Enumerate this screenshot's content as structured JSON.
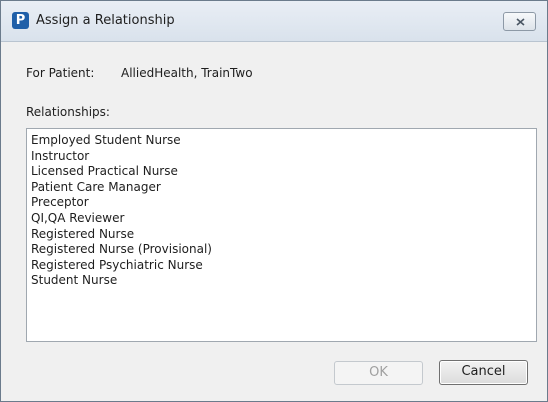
{
  "window": {
    "title": "Assign a Relationship",
    "app_icon_letter": "P"
  },
  "patient": {
    "label": "For Patient:",
    "name": "AlliedHealth, TrainTwo"
  },
  "relationships": {
    "label": "Relationships:",
    "items": [
      "Employed Student Nurse",
      "Instructor",
      "Licensed Practical Nurse",
      "Patient Care Manager",
      "Preceptor",
      "QI,QA Reviewer",
      "Registered Nurse",
      "Registered Nurse (Provisional)",
      "Registered Psychiatric Nurse",
      "Student Nurse"
    ]
  },
  "buttons": {
    "ok_label": "OK",
    "ok_enabled": false,
    "cancel_label": "Cancel"
  },
  "colors": {
    "app_icon": "#1f5fa8",
    "dialog_bg": "#f0f0f0",
    "disabled_text": "#a0a0a0"
  },
  "icons": {
    "app": "app-logo-icon",
    "close": "close-icon"
  }
}
